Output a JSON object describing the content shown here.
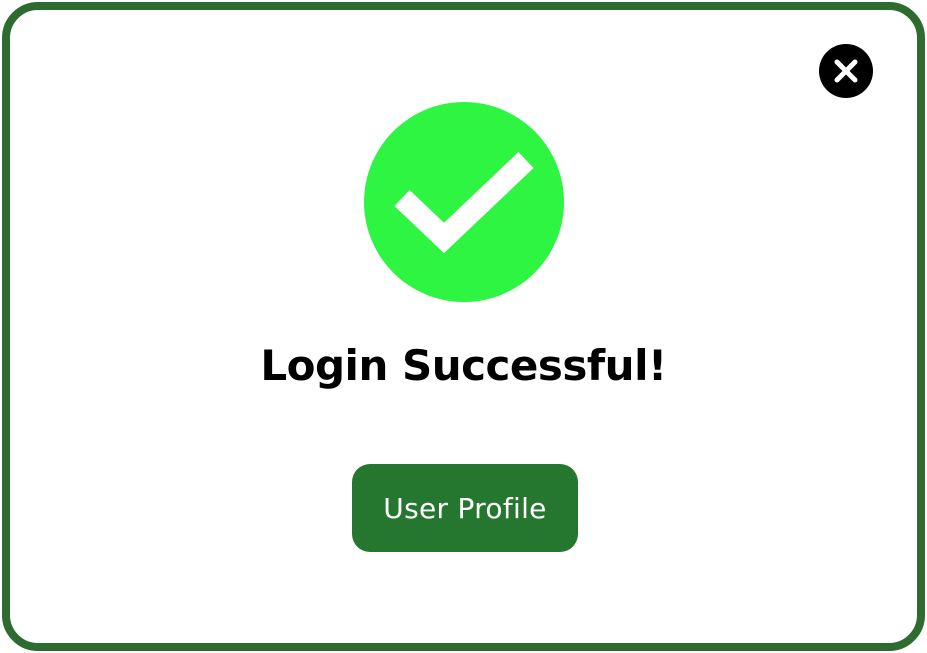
{
  "dialog": {
    "title": "Login Successful!",
    "button_label": "User Profile",
    "icons": {
      "close": "close-icon",
      "success": "checkmark-icon"
    }
  },
  "colors": {
    "frame_border": "#2e6b2f",
    "success_circle": "#2ef542",
    "checkmark": "#ffffff",
    "button_background": "#257730",
    "button_text": "#ffffff",
    "close_background": "#000000"
  }
}
